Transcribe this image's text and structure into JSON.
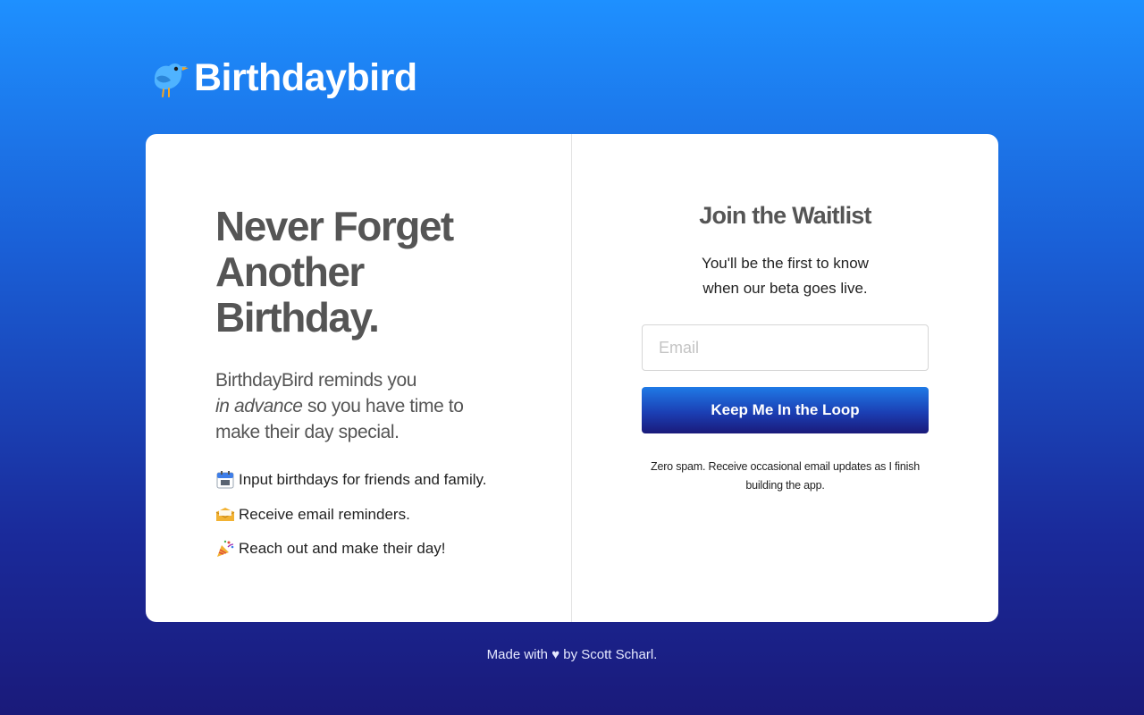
{
  "header": {
    "logo_icon": "bird-icon",
    "brand_name": "Birthdaybird"
  },
  "hero": {
    "title_line1": "Never Forget",
    "title_line2": "Another",
    "title_line3": "Birthday.",
    "subtitle_pre": "BirthdayBird reminds you",
    "subtitle_em": "in advance",
    "subtitle_post": "so you have time to make their day special."
  },
  "features": [
    {
      "icon": "calendar-icon",
      "text": "Input birthdays for friends and family."
    },
    {
      "icon": "envelope-icon",
      "text": "Receive email reminders."
    },
    {
      "icon": "party-popper-icon",
      "text": "Reach out and make their day!"
    }
  ],
  "waitlist": {
    "title": "Join the Waitlist",
    "desc_line1": "You'll be the first to know",
    "desc_line2": "when our beta goes live.",
    "email_placeholder": "Email",
    "email_value": "",
    "button_label": "Keep Me In the Loop",
    "fine_line1": "Zero spam. Receive occasional email updates as I finish",
    "fine_line2": "building the app."
  },
  "footer": {
    "prefix": "Made with",
    "heart": "♥",
    "by": "by",
    "author": "Scott Scharl."
  },
  "colors": {
    "bg_top": "#1e90ff",
    "bg_bottom": "#1a1a7a",
    "heading_gray": "#555555",
    "button_top": "#1f7ae6",
    "button_bottom": "#1a1a7a"
  }
}
